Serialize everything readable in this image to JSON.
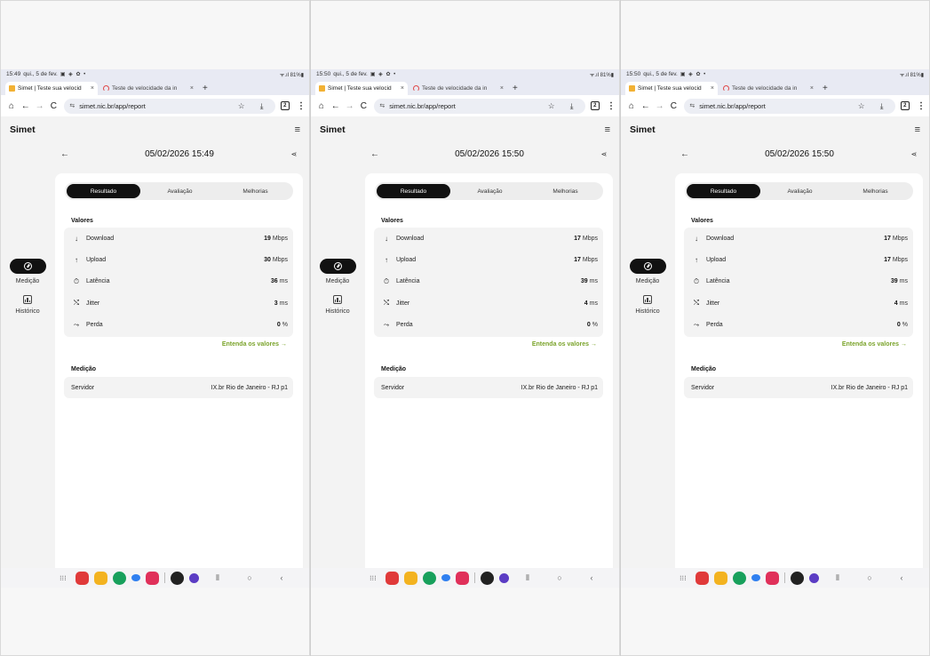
{
  "shared": {
    "tab_active_title": "Simet | Teste sua velocid",
    "tab_inactive_title": "Teste de velocidade da in",
    "tab_close": "×",
    "tab_add": "+",
    "url": "simet.nic.br/app/report",
    "tabs_count": "2",
    "brand": "Simet",
    "segments": [
      "Resultado",
      "Avaliação",
      "Melhorias"
    ],
    "values_heading": "Valores",
    "rows": {
      "download": {
        "label": "Download",
        "unit": "Mbps"
      },
      "upload": {
        "label": "Upload",
        "unit": "Mbps"
      },
      "latency": {
        "label": "Latência",
        "unit": "ms"
      },
      "jitter": {
        "label": "Jitter",
        "unit": "ms"
      },
      "loss": {
        "label": "Perda",
        "unit": "%"
      }
    },
    "learn_more": "Entenda os valores",
    "measurement_heading": "Medição",
    "server_label": "Servidor",
    "server_value": "IX.br Rio de Janeiro - RJ p1",
    "rail": {
      "measure": "Medição",
      "history": "Histórico"
    },
    "status_date": "qui., 5 de fev.",
    "battery": "81%"
  },
  "panels": [
    {
      "time": "15:49",
      "title": "05/02/2026 15:49",
      "download": "19",
      "upload": "30",
      "latency": "36",
      "jitter": "3",
      "loss": "0"
    },
    {
      "time": "15:50",
      "title": "05/02/2026 15:50",
      "download": "17",
      "upload": "17",
      "latency": "39",
      "jitter": "4",
      "loss": "0"
    },
    {
      "time": "15:50",
      "title": "05/02/2026 15:50",
      "download": "17",
      "upload": "17",
      "latency": "39",
      "jitter": "4",
      "loss": "0"
    }
  ],
  "icons": {
    "home": "⌂",
    "back": "←",
    "forward": "→",
    "reload": "C",
    "tune": "⇆",
    "star": "☆",
    "download": "⤓",
    "menu": "⋮",
    "hamburger": "≡",
    "arrow_down": "↓",
    "arrow_up": "↑",
    "timer": "⏱",
    "jitter": "⤭",
    "loss": "⤳",
    "share": "⋖",
    "link_arrow": "→",
    "grid": "⁝⁝⁝",
    "nav_recent": "⦀",
    "nav_home": "○",
    "nav_back": "‹"
  }
}
